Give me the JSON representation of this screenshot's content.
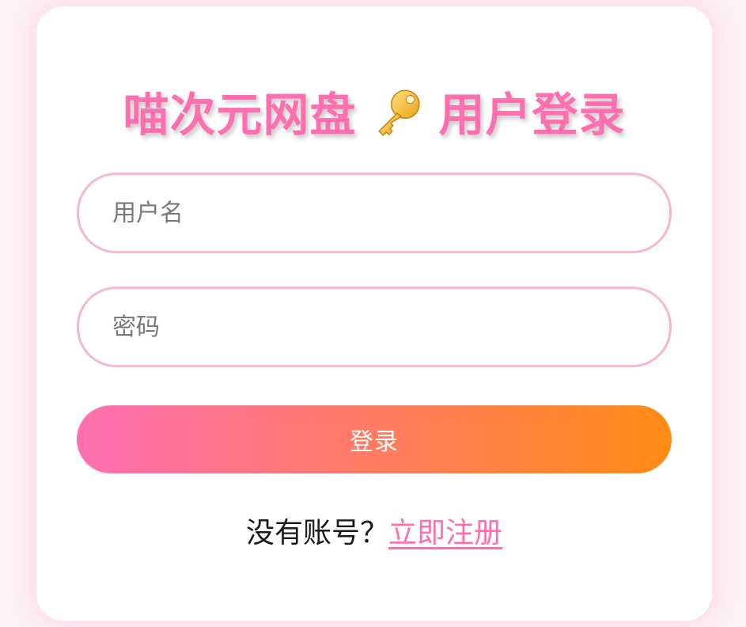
{
  "login": {
    "title_prefix": "喵次元网盘",
    "title_icon": "key-icon",
    "title_suffix": "用户登录",
    "username_placeholder": "用户名",
    "username_value": "",
    "password_placeholder": "密码",
    "password_value": "",
    "login_button_label": "登录",
    "no_account_text": "没有账号？",
    "register_link_label": "立即注册"
  },
  "colors": {
    "title": "#ff6fb0",
    "field_border": "#f7b7c8",
    "button_gradient_start": "#ff6fb3",
    "button_gradient_end": "#ff8c14",
    "link": "#ff6fb0"
  }
}
